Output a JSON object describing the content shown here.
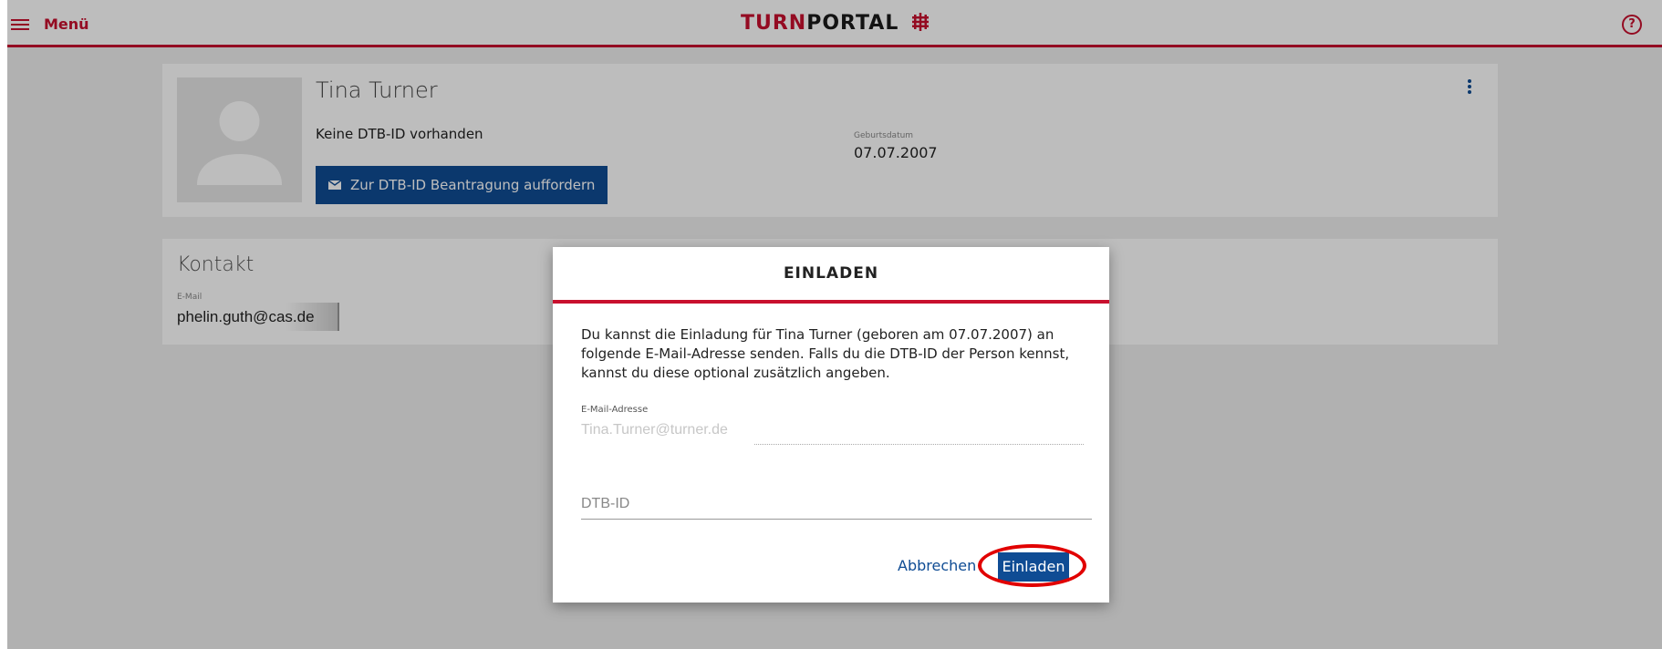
{
  "header": {
    "menu_label": "Menü",
    "logo_red": "TURN",
    "logo_dark": "PORTAL",
    "help_glyph": "?"
  },
  "profile": {
    "name": "Tina Turner",
    "dtb_status": "Keine DTB-ID vorhanden",
    "request_button_label": "Zur DTB-ID Beantragung auffordern",
    "birthdate_label": "Geburtsdatum",
    "birthdate_value": "07.07.2007"
  },
  "contact": {
    "title": "Kontakt",
    "email_label": "E-Mail",
    "email_value": "phelin.guth@cas.de"
  },
  "dialog": {
    "title": "EINLADEN",
    "text": "Du kannst die Einladung für Tina Turner (geboren am 07.07.2007) an folgende E-Mail-Adresse senden. Falls du die DTB-ID der Person kennst, kannst du diese optional zusätzlich angeben.",
    "email_field_label": "E-Mail-Adresse",
    "email_field_value": "Tina.Turner@turner.de",
    "dtb_placeholder": "DTB-ID",
    "cancel_label": "Abbrechen",
    "invite_label": "Einladen"
  },
  "colors": {
    "brand_red": "#c8102e",
    "primary_blue": "#0f4c94",
    "highlight_red": "#e10000"
  }
}
